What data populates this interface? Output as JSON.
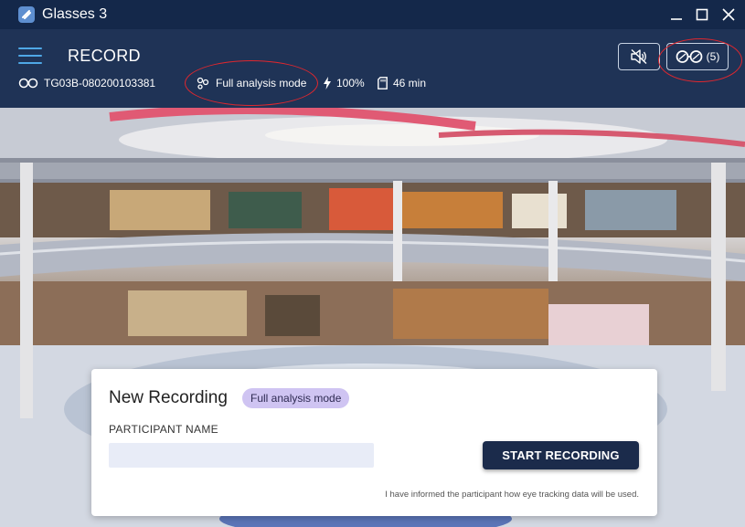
{
  "window": {
    "title": "Glasses 3",
    "controls": [
      "minimize",
      "maximize",
      "close"
    ]
  },
  "header": {
    "page_title": "RECORD",
    "serial": "TG03B-080200103381",
    "mode": "Full analysis mode",
    "battery": "100%",
    "storage": "46 min",
    "glasses_count": "(5)",
    "icons": {
      "menu": "hamburger-icon",
      "glasses": "glasses-icon",
      "mode": "gaze-analysis-icon",
      "battery": "lightning-icon",
      "storage": "sd-card-icon",
      "mute": "speaker-muted-icon"
    }
  },
  "card": {
    "title": "New Recording",
    "mode_badge": "Full analysis mode",
    "participant_label": "PARTICIPANT NAME",
    "participant_value": "",
    "start_button": "START RECORDING",
    "consent_text": "I have informed the participant how eye tracking data will be used."
  },
  "colors": {
    "titlebar": "#14284a",
    "header": "#1f3356",
    "accent": "#4fa8e6",
    "highlight": "#e0272e",
    "badge": "#cfc4f2",
    "button": "#1b2b4b"
  }
}
